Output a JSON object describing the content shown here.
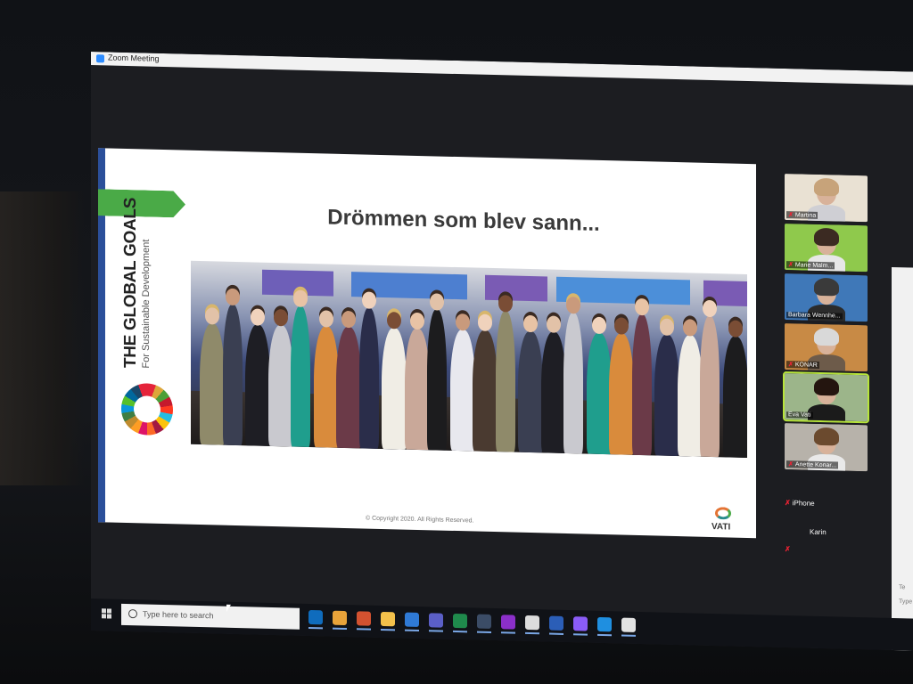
{
  "window": {
    "title": "Zoom Meeting"
  },
  "slide": {
    "heading": "Drömmen som blev sann...",
    "logo_title": "THE GLOBAL GOALS",
    "logo_subtitle": "For Sustainable Development",
    "copyright": "© Copyright 2020. All Rights Reserved.",
    "brand": "VATI"
  },
  "participants": [
    {
      "name": "Martina",
      "muted": true,
      "bg": "#e9e1d3",
      "hair": "#c7a37a",
      "shirt": "#cfcfd4"
    },
    {
      "name": "Marie Malm...",
      "muted": true,
      "bg": "#8fc94c",
      "hair": "#3b2a22",
      "shirt": "#e7e7e7"
    },
    {
      "name": "Barbara Wennhe...",
      "muted": false,
      "bg": "#3f78b8",
      "hair": "#3a3a3a",
      "shirt": "#2b2b2b"
    },
    {
      "name": "KONAR",
      "muted": true,
      "bg": "#c88a45",
      "hair": "#d9d9d9",
      "shirt": "#6d5b4a"
    },
    {
      "name": "Eva Vati",
      "muted": false,
      "active": true,
      "bg": "#9cb58a",
      "hair": "#24150f",
      "shirt": "#1b1b1b"
    },
    {
      "name": "Anette Konar...",
      "muted": true,
      "bg": "#b7b2aa",
      "hair": "#6b4a2e",
      "shirt": "#e9e9e9"
    }
  ],
  "audio_participants": [
    {
      "name": "iPhone",
      "muted": true
    },
    {
      "name": "Karin",
      "muted": false
    },
    {
      "name": "",
      "muted": true
    }
  ],
  "side_panel": {
    "lines": [
      "Te",
      "Type"
    ]
  },
  "taskbar": {
    "search_placeholder": "Type here to search",
    "apps": [
      {
        "name": "outlook-icon",
        "color": "#0f6cbd"
      },
      {
        "name": "chrome-icon",
        "color": "#e8a33a"
      },
      {
        "name": "powerpoint-icon",
        "color": "#d35230"
      },
      {
        "name": "file-explorer-icon",
        "color": "#f3c14b"
      },
      {
        "name": "mail-icon",
        "color": "#2f7ad6"
      },
      {
        "name": "teams-icon",
        "color": "#5b5fc7"
      },
      {
        "name": "excel-icon",
        "color": "#1f8a4c"
      },
      {
        "name": "zoom-icon",
        "color": "#2d8cff"
      },
      {
        "name": "onenote-icon",
        "color": "#8b2fc9"
      },
      {
        "name": "files-icon",
        "color": "#dcdcdc"
      },
      {
        "name": "word-icon",
        "color": "#2b5eb7"
      },
      {
        "name": "cortana-icon",
        "color": "#8a5cf6"
      },
      {
        "name": "edge-icon",
        "color": "#1f8fe0"
      },
      {
        "name": "pdf-icon",
        "color": "#e2e2e2"
      }
    ]
  }
}
